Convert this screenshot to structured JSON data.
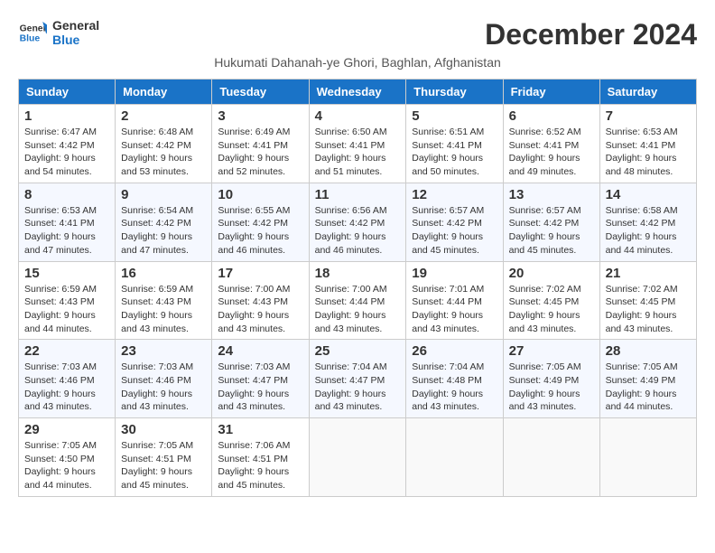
{
  "logo": {
    "line1": "General",
    "line2": "Blue"
  },
  "title": "December 2024",
  "subtitle": "Hukumati Dahanah-ye Ghori, Baghlan, Afghanistan",
  "weekdays": [
    "Sunday",
    "Monday",
    "Tuesday",
    "Wednesday",
    "Thursday",
    "Friday",
    "Saturday"
  ],
  "weeks": [
    [
      {
        "day": "1",
        "sunrise": "6:47 AM",
        "sunset": "4:42 PM",
        "daylight": "9 hours and 54 minutes."
      },
      {
        "day": "2",
        "sunrise": "6:48 AM",
        "sunset": "4:42 PM",
        "daylight": "9 hours and 53 minutes."
      },
      {
        "day": "3",
        "sunrise": "6:49 AM",
        "sunset": "4:41 PM",
        "daylight": "9 hours and 52 minutes."
      },
      {
        "day": "4",
        "sunrise": "6:50 AM",
        "sunset": "4:41 PM",
        "daylight": "9 hours and 51 minutes."
      },
      {
        "day": "5",
        "sunrise": "6:51 AM",
        "sunset": "4:41 PM",
        "daylight": "9 hours and 50 minutes."
      },
      {
        "day": "6",
        "sunrise": "6:52 AM",
        "sunset": "4:41 PM",
        "daylight": "9 hours and 49 minutes."
      },
      {
        "day": "7",
        "sunrise": "6:53 AM",
        "sunset": "4:41 PM",
        "daylight": "9 hours and 48 minutes."
      }
    ],
    [
      {
        "day": "8",
        "sunrise": "6:53 AM",
        "sunset": "4:41 PM",
        "daylight": "9 hours and 47 minutes."
      },
      {
        "day": "9",
        "sunrise": "6:54 AM",
        "sunset": "4:42 PM",
        "daylight": "9 hours and 47 minutes."
      },
      {
        "day": "10",
        "sunrise": "6:55 AM",
        "sunset": "4:42 PM",
        "daylight": "9 hours and 46 minutes."
      },
      {
        "day": "11",
        "sunrise": "6:56 AM",
        "sunset": "4:42 PM",
        "daylight": "9 hours and 46 minutes."
      },
      {
        "day": "12",
        "sunrise": "6:57 AM",
        "sunset": "4:42 PM",
        "daylight": "9 hours and 45 minutes."
      },
      {
        "day": "13",
        "sunrise": "6:57 AM",
        "sunset": "4:42 PM",
        "daylight": "9 hours and 45 minutes."
      },
      {
        "day": "14",
        "sunrise": "6:58 AM",
        "sunset": "4:42 PM",
        "daylight": "9 hours and 44 minutes."
      }
    ],
    [
      {
        "day": "15",
        "sunrise": "6:59 AM",
        "sunset": "4:43 PM",
        "daylight": "9 hours and 44 minutes."
      },
      {
        "day": "16",
        "sunrise": "6:59 AM",
        "sunset": "4:43 PM",
        "daylight": "9 hours and 43 minutes."
      },
      {
        "day": "17",
        "sunrise": "7:00 AM",
        "sunset": "4:43 PM",
        "daylight": "9 hours and 43 minutes."
      },
      {
        "day": "18",
        "sunrise": "7:00 AM",
        "sunset": "4:44 PM",
        "daylight": "9 hours and 43 minutes."
      },
      {
        "day": "19",
        "sunrise": "7:01 AM",
        "sunset": "4:44 PM",
        "daylight": "9 hours and 43 minutes."
      },
      {
        "day": "20",
        "sunrise": "7:02 AM",
        "sunset": "4:45 PM",
        "daylight": "9 hours and 43 minutes."
      },
      {
        "day": "21",
        "sunrise": "7:02 AM",
        "sunset": "4:45 PM",
        "daylight": "9 hours and 43 minutes."
      }
    ],
    [
      {
        "day": "22",
        "sunrise": "7:03 AM",
        "sunset": "4:46 PM",
        "daylight": "9 hours and 43 minutes."
      },
      {
        "day": "23",
        "sunrise": "7:03 AM",
        "sunset": "4:46 PM",
        "daylight": "9 hours and 43 minutes."
      },
      {
        "day": "24",
        "sunrise": "7:03 AM",
        "sunset": "4:47 PM",
        "daylight": "9 hours and 43 minutes."
      },
      {
        "day": "25",
        "sunrise": "7:04 AM",
        "sunset": "4:47 PM",
        "daylight": "9 hours and 43 minutes."
      },
      {
        "day": "26",
        "sunrise": "7:04 AM",
        "sunset": "4:48 PM",
        "daylight": "9 hours and 43 minutes."
      },
      {
        "day": "27",
        "sunrise": "7:05 AM",
        "sunset": "4:49 PM",
        "daylight": "9 hours and 43 minutes."
      },
      {
        "day": "28",
        "sunrise": "7:05 AM",
        "sunset": "4:49 PM",
        "daylight": "9 hours and 44 minutes."
      }
    ],
    [
      {
        "day": "29",
        "sunrise": "7:05 AM",
        "sunset": "4:50 PM",
        "daylight": "9 hours and 44 minutes."
      },
      {
        "day": "30",
        "sunrise": "7:05 AM",
        "sunset": "4:51 PM",
        "daylight": "9 hours and 45 minutes."
      },
      {
        "day": "31",
        "sunrise": "7:06 AM",
        "sunset": "4:51 PM",
        "daylight": "9 hours and 45 minutes."
      },
      null,
      null,
      null,
      null
    ]
  ]
}
